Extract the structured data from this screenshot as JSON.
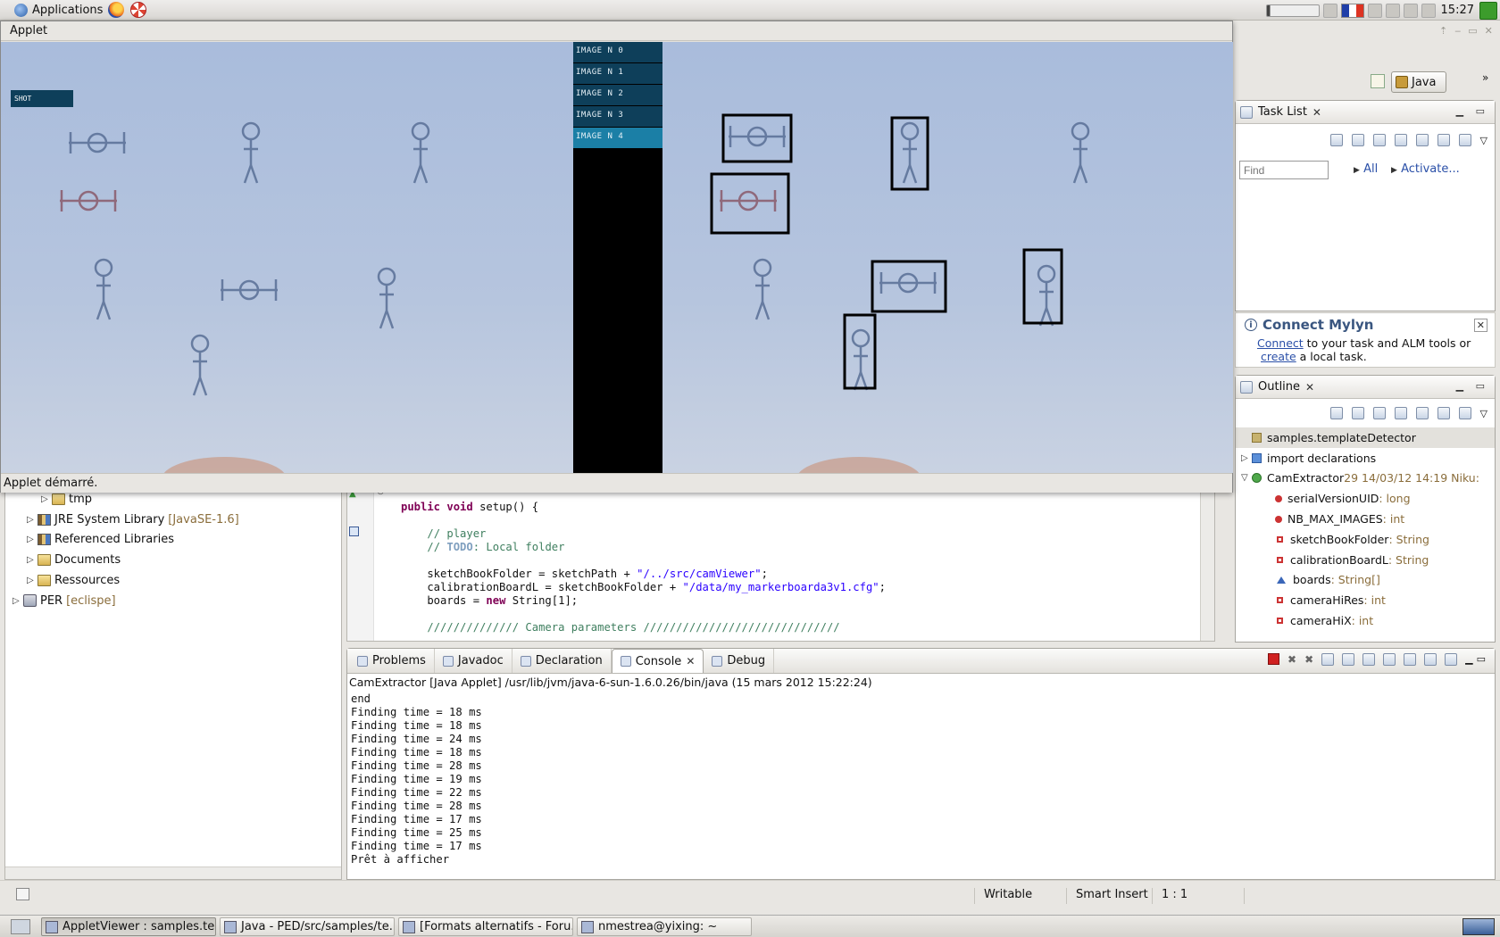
{
  "colors": {
    "accent": "#1b7fa6",
    "image_button": "#0e3f5a",
    "keyword": "#7f0055",
    "comment": "#3f7f5f",
    "string": "#2a00ff",
    "decoration": "#8a6d3b",
    "link": "#2b50a8"
  },
  "top_panel": {
    "menu_label": "Applications",
    "clock": "15:27",
    "icons": [
      "applications-logo-icon",
      "firefox-icon",
      "help-icon",
      "volume-icon",
      "flag-fr-icon",
      "network-icon",
      "power-icon"
    ]
  },
  "applet": {
    "menu": "Applet",
    "shot_label": "SHOT",
    "image_buttons": [
      "IMAGE N 0",
      "IMAGE N 1",
      "IMAGE N 2",
      "IMAGE N 3",
      "IMAGE N 4"
    ],
    "selected_image": 4,
    "status": "Applet démarré."
  },
  "perspective": {
    "label": "Java"
  },
  "task_list": {
    "title": "Task List",
    "find_placeholder": "Find",
    "all_label": "All",
    "activate_label": "Activate..."
  },
  "mylyn": {
    "title": "Connect Mylyn",
    "connect": "Connect",
    "text1": " to your task and ALM tools or",
    "create": "create",
    "text2": " a local task."
  },
  "outline": {
    "title": "Outline",
    "items": [
      {
        "name": "samples.templateDetector",
        "detail": "",
        "kind": "pkg",
        "level": 0,
        "selected": true
      },
      {
        "name": "import declarations",
        "detail": "",
        "kind": "imp",
        "level": 0,
        "twisty": "closed"
      },
      {
        "name": "CamExtractor",
        "detail": " 29  14/03/12 14:19  Niku:",
        "kind": "cls",
        "level": 0,
        "twisty": "open"
      },
      {
        "name": "serialVersionUID",
        "detail": " : long",
        "kind": "fldS",
        "level": 1
      },
      {
        "name": "NB_MAX_IMAGES",
        "detail": " : int",
        "kind": "fldS",
        "level": 1
      },
      {
        "name": "sketchBookFolder",
        "detail": " : String",
        "kind": "fld",
        "level": 1
      },
      {
        "name": "calibrationBoardL",
        "detail": " : String",
        "kind": "fld",
        "level": 1
      },
      {
        "name": "boards",
        "detail": " : String[]",
        "kind": "tri",
        "level": 1
      },
      {
        "name": "cameraHiRes",
        "detail": " : int",
        "kind": "fld",
        "level": 1
      },
      {
        "name": "cameraHiX",
        "detail": " : int",
        "kind": "fld",
        "level": 1
      }
    ]
  },
  "package_explorer": {
    "items": [
      {
        "label": "tmp",
        "deco": "",
        "indent": 2,
        "icon": "folder",
        "twisty": "closed"
      },
      {
        "label": "JRE System Library",
        "deco": "[JavaSE-1.6]",
        "indent": 1,
        "icon": "library",
        "twisty": "closed"
      },
      {
        "label": "Referenced Libraries",
        "deco": "",
        "indent": 1,
        "icon": "library",
        "twisty": "closed"
      },
      {
        "label": "Documents",
        "deco": "",
        "indent": 1,
        "icon": "folder",
        "twisty": "closed"
      },
      {
        "label": "Ressources",
        "deco": "",
        "indent": 1,
        "icon": "folder",
        "twisty": "closed"
      },
      {
        "label": "PER",
        "deco": "[eclispe]",
        "indent": 0,
        "icon": "project",
        "twisty": "closed"
      }
    ]
  },
  "editor": {
    "lines": [
      [
        [
          "kw",
          "public void "
        ],
        [
          "",
          "setup() {"
        ]
      ],
      [],
      [
        [
          "",
          "    "
        ],
        [
          "cm",
          "// player"
        ]
      ],
      [
        [
          "",
          "    "
        ],
        [
          "cm",
          "// "
        ],
        [
          "todo",
          "TODO"
        ],
        [
          "cm",
          ": Local folder"
        ]
      ],
      [],
      [
        [
          "",
          "    sketchBookFolder = sketchPath + "
        ],
        [
          "st",
          "\"/../src/camViewer\""
        ],
        [
          "",
          ";"
        ]
      ],
      [
        [
          "",
          "    calibrationBoardL = sketchBookFolder + "
        ],
        [
          "st",
          "\"/data/my_markerboarda3v1.cfg\""
        ],
        [
          "",
          ";"
        ]
      ],
      [
        [
          "",
          "    boards = "
        ],
        [
          "kw",
          "new "
        ],
        [
          "",
          "String[1];"
        ]
      ],
      [],
      [
        [
          "",
          "    "
        ],
        [
          "cm",
          "////////////// Camera parameters //////////////////////////////"
        ]
      ]
    ]
  },
  "bottom_tabs": [
    {
      "label": "Problems",
      "icon": "problems-icon",
      "active": false,
      "closable": false
    },
    {
      "label": "Javadoc",
      "icon": "javadoc-icon",
      "active": false,
      "closable": false
    },
    {
      "label": "Declaration",
      "icon": "declaration-icon",
      "active": false,
      "closable": false
    },
    {
      "label": "Console",
      "icon": "console-icon",
      "active": true,
      "closable": true
    },
    {
      "label": "Debug",
      "icon": "debug-icon",
      "active": false,
      "closable": false
    }
  ],
  "console": {
    "launch": "CamExtractor [Java Applet] /usr/lib/jvm/java-6-sun-1.6.0.26/bin/java (15 mars 2012 15:22:24)",
    "lines": [
      "end",
      "Finding time = 18 ms",
      "Finding time = 18 ms",
      "Finding time = 24 ms",
      "Finding time = 18 ms",
      "Finding time = 28 ms",
      "Finding time = 19 ms",
      "Finding time = 22 ms",
      "Finding time = 28 ms",
      "Finding time = 17 ms",
      "Finding time = 25 ms",
      "Finding time = 17 ms",
      "Prêt à afficher"
    ]
  },
  "status_bar": {
    "writable": "Writable",
    "insert_mode": "Smart Insert",
    "position": "1 : 1"
  },
  "taskbar": [
    {
      "label": "AppletViewer : samples.te...",
      "pressed": true
    },
    {
      "label": "Java - PED/src/samples/te...",
      "pressed": false
    },
    {
      "label": "[Formats alternatifs - Foru...",
      "pressed": false
    },
    {
      "label": "nmestrea@yixing: ~",
      "pressed": false
    }
  ]
}
